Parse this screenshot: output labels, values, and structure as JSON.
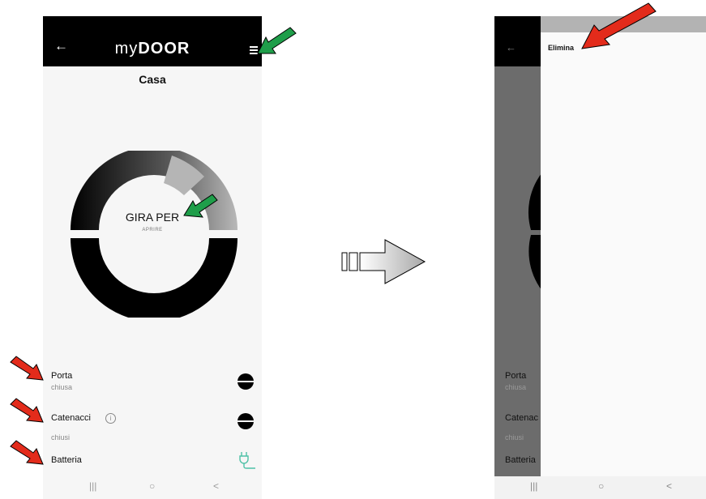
{
  "left_screen": {
    "header": {
      "back_icon": "arrow-left-icon",
      "logo_thin": "my",
      "logo_bold": "DOOR",
      "menu_icon": "hamburger-menu-icon"
    },
    "title": "Casa",
    "dial": {
      "main_label": "GIRA PER",
      "sub_label": "APRIRE"
    },
    "rows": [
      {
        "label": "Porta",
        "value": "chiusa",
        "icon": "lock-closed-disc-icon"
      },
      {
        "label": "Catenacci",
        "value": "chiusi",
        "icon": "lock-closed-disc-icon",
        "info_icon": "i"
      },
      {
        "label": "Batteria",
        "value": "",
        "icon": "plug-icon"
      }
    ],
    "nav": {
      "recent": "|||",
      "home": "○",
      "back": "<"
    }
  },
  "right_screen": {
    "drawer_item": "Elimina",
    "dim_rows": [
      {
        "label": "Porta",
        "value": "chiusa"
      },
      {
        "label": "Catenac",
        "value": "chiusi"
      },
      {
        "label": "Batteria",
        "value": ""
      }
    ],
    "nav": {
      "recent": "|||",
      "home": "○",
      "back": "<"
    }
  },
  "colors": {
    "header": "#000000",
    "screen_bg": "#f6f6f6",
    "annotation_green": "#1f9e4a",
    "annotation_red": "#e32b1b",
    "plug": "#4fc1a7"
  }
}
